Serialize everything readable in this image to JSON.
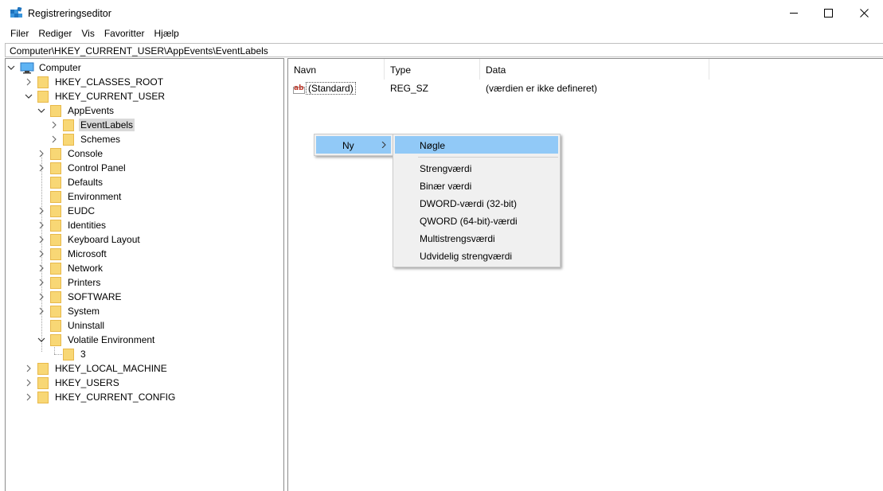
{
  "window": {
    "title": "Registreringseditor"
  },
  "menu": [
    "Filer",
    "Rediger",
    "Vis",
    "Favoritter",
    "Hjælp"
  ],
  "address": "Computer\\HKEY_CURRENT_USER\\AppEvents\\EventLabels",
  "tree": {
    "root": "Computer",
    "hives": {
      "classes_root": "HKEY_CLASSES_ROOT",
      "current_user": "HKEY_CURRENT_USER",
      "local_machine": "HKEY_LOCAL_MACHINE",
      "users": "HKEY_USERS",
      "current_config": "HKEY_CURRENT_CONFIG"
    },
    "appevents": "AppEvents",
    "eventlabels": "EventLabels",
    "schemes": "Schemes",
    "hkcu_children": [
      "Console",
      "Control Panel",
      "Defaults",
      "Environment",
      "EUDC",
      "Identities",
      "Keyboard Layout",
      "Microsoft",
      "Network",
      "Printers",
      "SOFTWARE",
      "System",
      "Uninstall",
      "Volatile Environment"
    ],
    "volatile_child": "3"
  },
  "list": {
    "columns": [
      "Navn",
      "Type",
      "Data"
    ],
    "rows": [
      {
        "name": "(Standard)",
        "type": "REG_SZ",
        "data": "(værdien er ikke defineret)"
      }
    ]
  },
  "context_menu": {
    "new_label": "Ny",
    "submenu": {
      "key": "Nøgle",
      "values": [
        "Strengværdi",
        "Binær værdi",
        "DWORD-værdi (32-bit)",
        "QWORD (64-bit)-værdi",
        "Multistrengsværdi",
        "Udvidelig strengværdi"
      ]
    }
  },
  "colors": {
    "folder": "#f8d775",
    "highlight": "#91c9f7",
    "selected_bg": "#d9d9d9"
  }
}
